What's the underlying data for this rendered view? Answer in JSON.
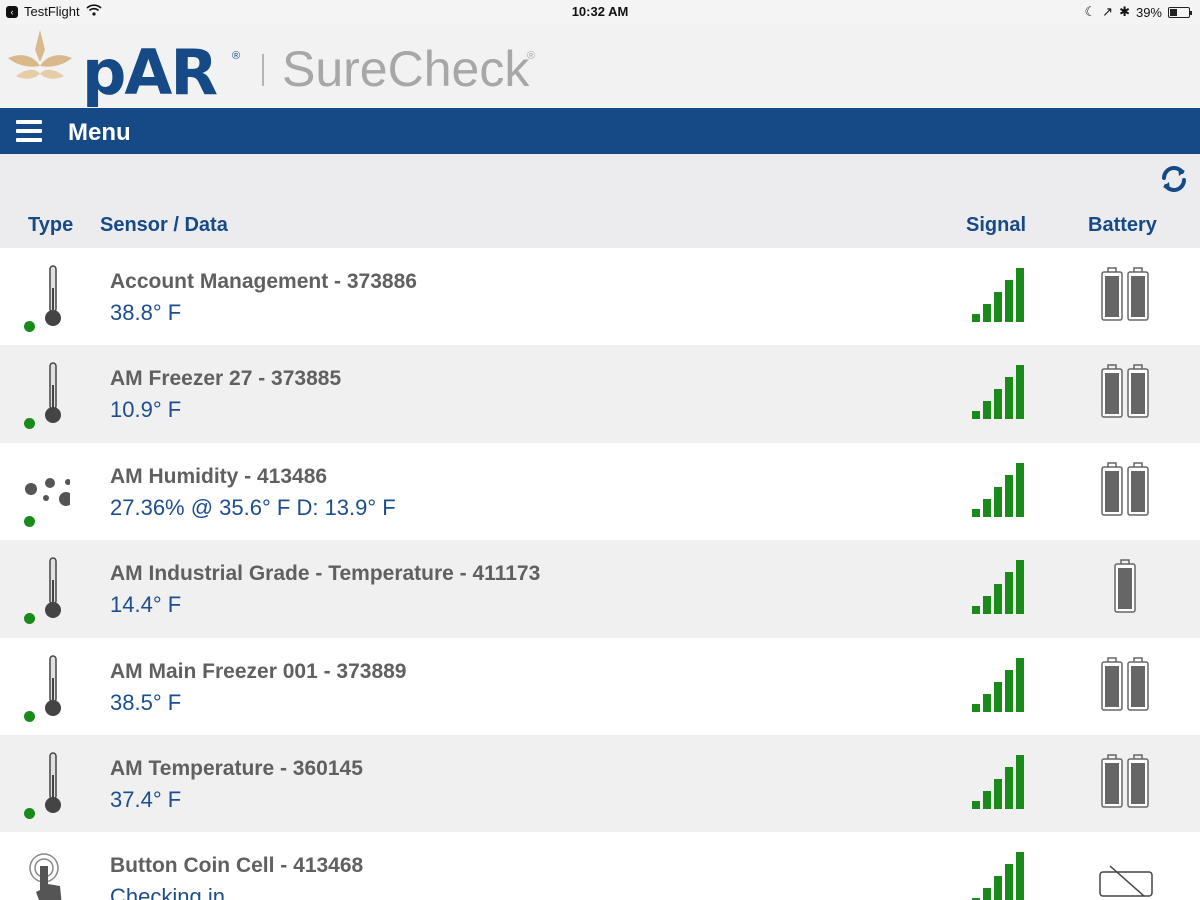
{
  "status_bar": {
    "back_app": "TestFlight",
    "time": "10:32 AM",
    "battery_percent": "39%",
    "battery_level": 0.39
  },
  "brand": {
    "company": "pAR",
    "product": "SureCheck",
    "registered_mark": "®",
    "logo_colors": {
      "primary": "#164a86",
      "accent": "#d9b98c",
      "muted": "#a7a7a7"
    }
  },
  "menu_bar": {
    "icon": "hamburger-icon",
    "label": "Menu",
    "background": "#164a86"
  },
  "toolbar": {
    "refresh_icon": "refresh-icon"
  },
  "columns": {
    "type": "Type",
    "sensor": "Sensor / Data",
    "signal": "Signal",
    "battery": "Battery"
  },
  "colors": {
    "status_ok": "#1a8a1a",
    "signal_bar": "#1a8a1a",
    "reading_text": "#1d4d8e",
    "name_text": "#606060"
  },
  "sensors": [
    {
      "type": "thermometer",
      "name": "Account Management - 373886",
      "reading": "38.8° F",
      "status": "ok",
      "signal_bars": 5,
      "battery": "dual"
    },
    {
      "type": "thermometer",
      "name": "AM Freezer 27 - 373885",
      "reading": "10.9° F",
      "status": "ok",
      "signal_bars": 5,
      "battery": "dual"
    },
    {
      "type": "humidity",
      "name": "AM Humidity - 413486",
      "reading": "27.36% @ 35.6° F D: 13.9° F",
      "status": "ok",
      "signal_bars": 5,
      "battery": "dual"
    },
    {
      "type": "thermometer",
      "name": "AM Industrial Grade - Temperature - 411173",
      "reading": "14.4° F",
      "status": "ok",
      "signal_bars": 5,
      "battery": "single"
    },
    {
      "type": "thermometer",
      "name": "AM Main Freezer 001 - 373889",
      "reading": "38.5° F",
      "status": "ok",
      "signal_bars": 5,
      "battery": "dual"
    },
    {
      "type": "thermometer",
      "name": "AM Temperature - 360145",
      "reading": "37.4° F",
      "status": "ok",
      "signal_bars": 5,
      "battery": "dual"
    },
    {
      "type": "button",
      "name": "Button Coin Cell - 413468",
      "reading": "Checking in",
      "status": "none",
      "signal_bars": 5,
      "battery": "coin"
    }
  ]
}
